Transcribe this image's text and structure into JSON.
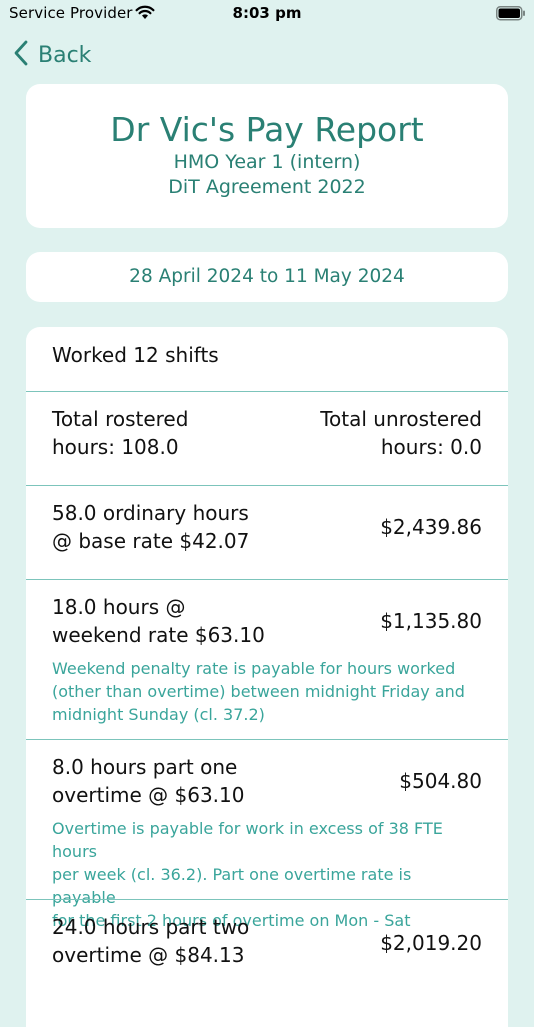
{
  "status": {
    "carrier": "Service Provider",
    "time": "8:03 pm"
  },
  "nav": {
    "back_label": "Back"
  },
  "header": {
    "title": "Dr Vic's Pay Report",
    "role": "HMO Year 1 (intern)",
    "agreement": "DiT Agreement 2022"
  },
  "period": "28 April 2024 to 11 May 2024",
  "report": {
    "shifts": "Worked 12 shifts",
    "rostered": {
      "line1": "Total rostered",
      "line2": "hours: 108.0"
    },
    "unrostered": {
      "line1": "Total unrostered",
      "line2": "hours: 0.0"
    },
    "items": [
      {
        "line1": "58.0 ordinary hours",
        "line2": "@ base rate $42.07",
        "amount": "$2,439.86",
        "note": ""
      },
      {
        "line1": "18.0 hours @",
        "line2": "weekend rate $63.10",
        "amount": "$1,135.80",
        "note_lines": [
          "Weekend penalty rate is payable for hours worked",
          "(other than overtime) between midnight Friday and",
          "midnight Sunday (cl. 37.2)"
        ]
      },
      {
        "line1": "8.0 hours part one",
        "line2": "overtime @ $63.10",
        "amount": "$504.80",
        "note_lines": [
          "Overtime is payable for work in excess of 38 FTE hours",
          "per week (cl. 36.2).  Part one overtime rate is payable",
          "for the first 2 hours of overtime on Mon - Sat"
        ]
      },
      {
        "line1": "24.0 hours part two",
        "line2": "overtime @ $84.13",
        "amount": "$2,019.20"
      }
    ]
  }
}
